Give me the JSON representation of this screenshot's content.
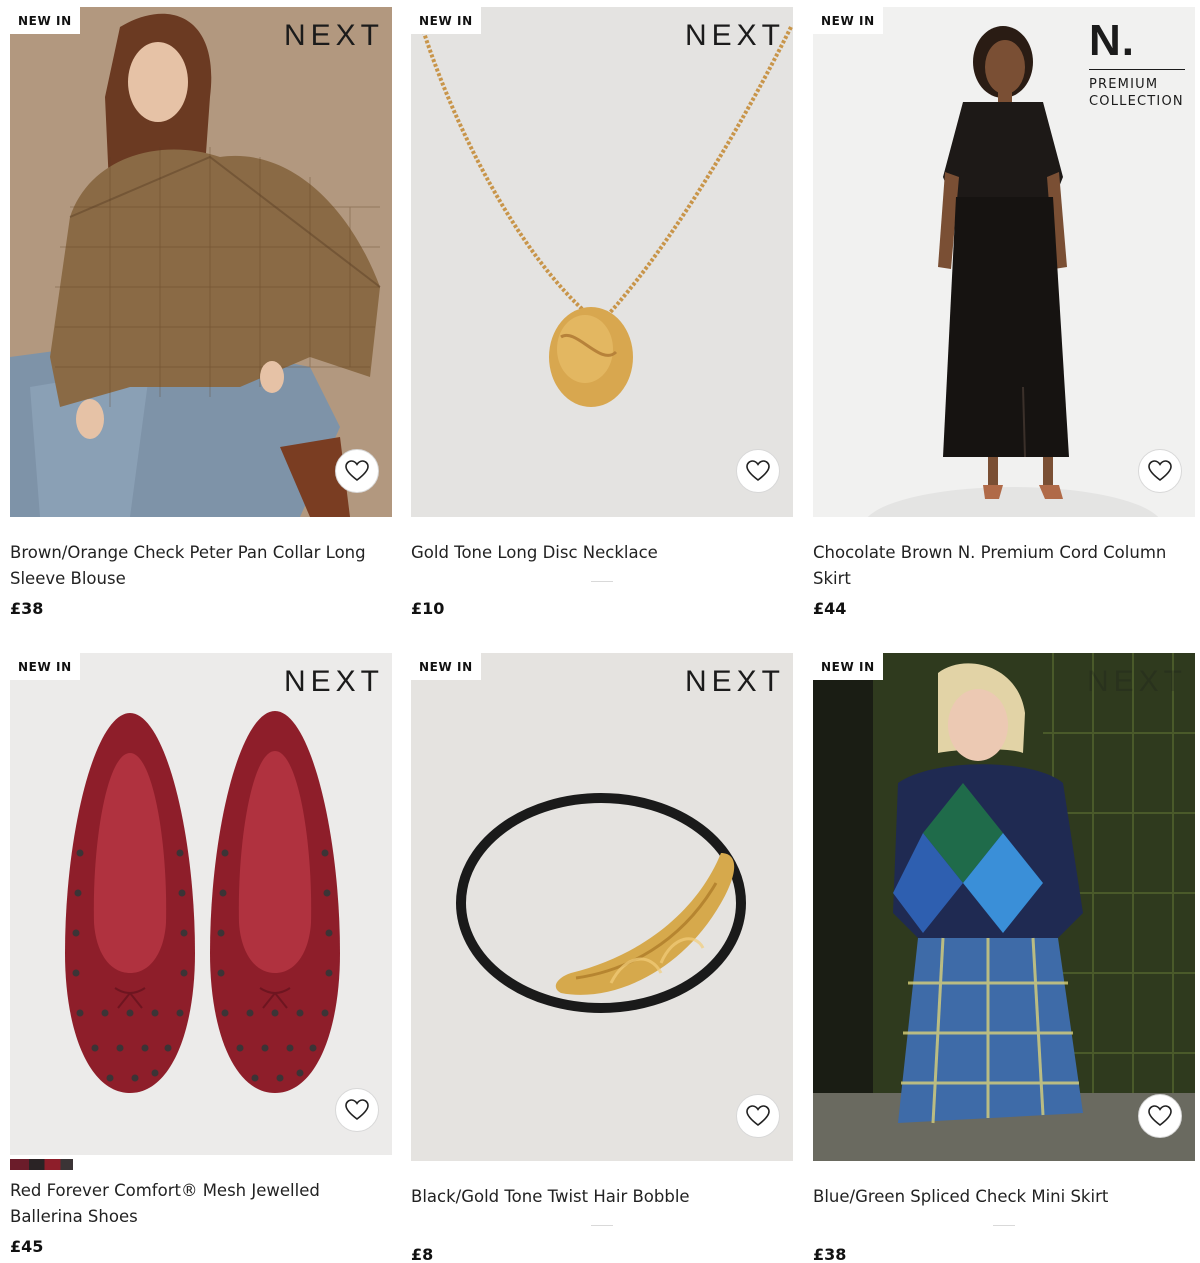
{
  "colors": {
    "badge_bg": "#ffffff",
    "text": "#222222",
    "price": "#111111",
    "fav_border": "#d8d8d8"
  },
  "icons": {
    "favourite": "heart-outline-icon"
  },
  "products": [
    {
      "badge": "NEW IN",
      "brand": "NEXT",
      "title": "Brown/Orange Check Peter Pan Collar Long Sleeve Blouse",
      "price": "£38"
    },
    {
      "badge": "NEW IN",
      "brand": "NEXT",
      "title": "Gold Tone Long Disc Necklace",
      "price": "£10"
    },
    {
      "badge": "NEW IN",
      "brand_premium": {
        "mark": "N.",
        "line1": "PREMIUM",
        "line2": "COLLECTION"
      },
      "title": "Chocolate Brown N. Premium Cord Column Skirt",
      "price": "£44"
    },
    {
      "badge": "NEW IN",
      "brand": "NEXT",
      "title": "Red Forever Comfort® Mesh Jewelled Ballerina Shoes",
      "price": "£45"
    },
    {
      "badge": "NEW IN",
      "brand": "NEXT",
      "title": "Black/Gold Tone Twist Hair Bobble",
      "price": "£8"
    },
    {
      "badge": "NEW IN",
      "brand": "NEXT",
      "title": "Blue/Green Spliced Check Mini Skirt",
      "price": "£38"
    }
  ]
}
